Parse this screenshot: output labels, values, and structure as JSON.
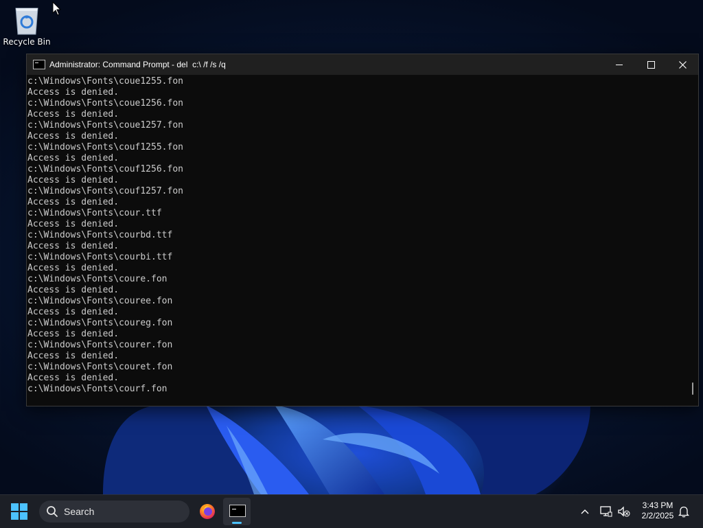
{
  "colors": {
    "console_bg": "#0c0c0c",
    "console_text": "#cccccc",
    "title_bar": "#202020",
    "taskbar": "#1c1f26",
    "accent": "#4cc2ff"
  },
  "desktop": {
    "icons": [
      {
        "label": "Recycle Bin",
        "icon": "recycle-bin-icon"
      }
    ]
  },
  "window": {
    "title": "Administrator: Command Prompt - del  c:\\ /f /s /q",
    "controls": {
      "minimize": "minimize-icon",
      "maximize": "maximize-icon",
      "close": "close-icon"
    },
    "lines": [
      "c:\\Windows\\Fonts\\coue1255.fon",
      "Access is denied.",
      "c:\\Windows\\Fonts\\coue1256.fon",
      "Access is denied.",
      "c:\\Windows\\Fonts\\coue1257.fon",
      "Access is denied.",
      "c:\\Windows\\Fonts\\couf1255.fon",
      "Access is denied.",
      "c:\\Windows\\Fonts\\couf1256.fon",
      "Access is denied.",
      "c:\\Windows\\Fonts\\couf1257.fon",
      "Access is denied.",
      "c:\\Windows\\Fonts\\cour.ttf",
      "Access is denied.",
      "c:\\Windows\\Fonts\\courbd.ttf",
      "Access is denied.",
      "c:\\Windows\\Fonts\\courbi.ttf",
      "Access is denied.",
      "c:\\Windows\\Fonts\\coure.fon",
      "Access is denied.",
      "c:\\Windows\\Fonts\\couree.fon",
      "Access is denied.",
      "c:\\Windows\\Fonts\\coureg.fon",
      "Access is denied.",
      "c:\\Windows\\Fonts\\courer.fon",
      "Access is denied.",
      "c:\\Windows\\Fonts\\couret.fon",
      "Access is denied.",
      "c:\\Windows\\Fonts\\courf.fon"
    ]
  },
  "taskbar": {
    "start_icon": "windows-start-icon",
    "search": {
      "label": "Search",
      "icon": "search-icon"
    },
    "apps": [
      {
        "name": "Firefox",
        "icon": "firefox-icon",
        "active": false
      },
      {
        "name": "Command Prompt",
        "icon": "command-prompt-icon",
        "active": true
      }
    ],
    "tray": {
      "icons": [
        "chevron-up-icon",
        "network-icon",
        "volume-muted-icon",
        "notifications-icon"
      ],
      "time": "3:43 PM",
      "date": "2/2/2025"
    }
  }
}
